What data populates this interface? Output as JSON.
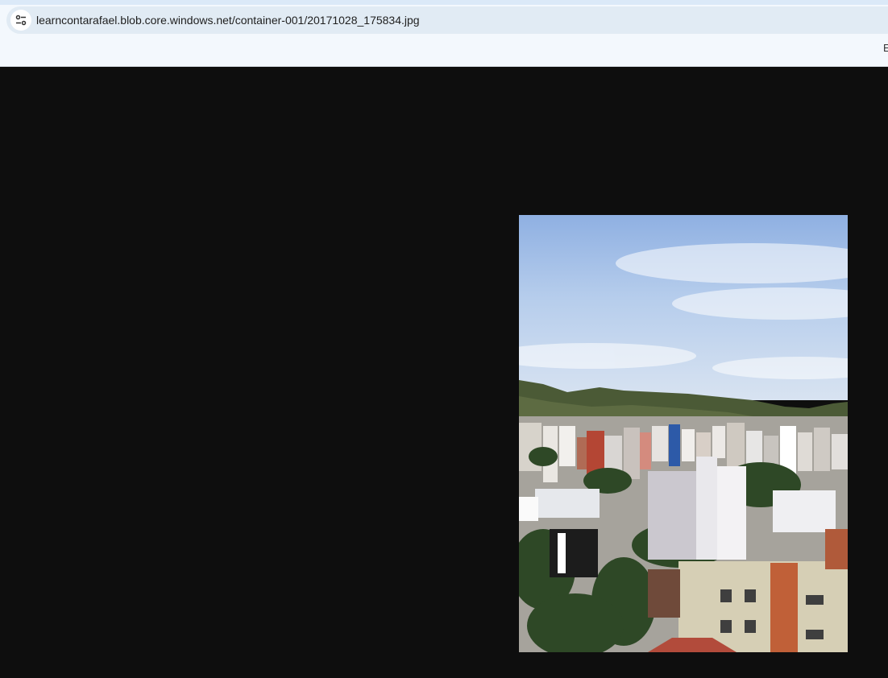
{
  "browser": {
    "address_bar": {
      "url": "learncontarafael.blob.core.windows.net/container-001/20171028_175834.jpg",
      "site_info_icon": "tune-icon"
    },
    "bookmarks_bar": {
      "edge_text": "E"
    }
  },
  "viewer": {
    "background_color": "#0e0e0e",
    "image": {
      "content": "city-skyline-photo"
    }
  }
}
